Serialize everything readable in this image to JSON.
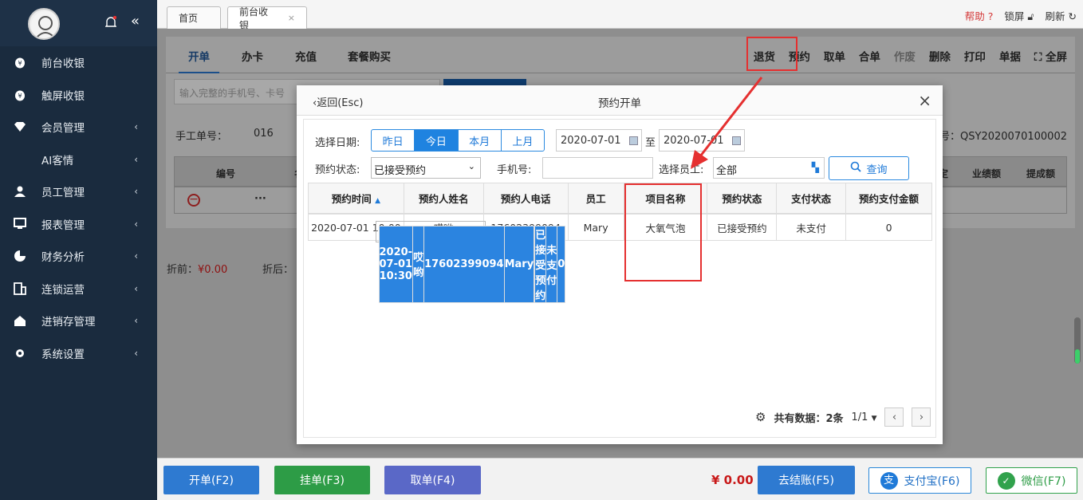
{
  "sidebar": {
    "items": [
      {
        "label": "前台收银",
        "icon": "cashier-icon",
        "arrow": ""
      },
      {
        "label": "触屏收银",
        "icon": "touch-cashier-icon",
        "arrow": ""
      },
      {
        "label": "会员管理",
        "icon": "diamond-icon",
        "arrow": "‹"
      },
      {
        "label": "AI客情",
        "icon": "",
        "arrow": "‹"
      },
      {
        "label": "员工管理",
        "icon": "person-icon",
        "arrow": "‹"
      },
      {
        "label": "报表管理",
        "icon": "monitor-icon",
        "arrow": "‹"
      },
      {
        "label": "财务分析",
        "icon": "pie-icon",
        "arrow": "‹"
      },
      {
        "label": "连锁运营",
        "icon": "building-icon",
        "arrow": "‹"
      },
      {
        "label": "进销存管理",
        "icon": "home-icon",
        "arrow": "‹"
      },
      {
        "label": "系统设置",
        "icon": "gear-icon",
        "arrow": "‹"
      }
    ]
  },
  "topbar": {
    "tabs": [
      {
        "label": "首页"
      },
      {
        "label": "前台收银",
        "close": "×"
      }
    ],
    "help": "帮助",
    "lock": "锁屏",
    "refresh": "刷新"
  },
  "main": {
    "subtabs": [
      "开单",
      "办卡",
      "充值",
      "套餐购买"
    ],
    "actions": [
      "退货",
      "预约",
      "取单",
      "合单",
      "作废",
      "删除",
      "打印",
      "单据",
      "全屏"
    ],
    "search_placeholder": "输入完整的手机号、卡号",
    "manual_label": "手工单号：",
    "manual_value": "016",
    "order_no": "号：QSY2020070100002",
    "grid_headers": [
      "编号",
      "名",
      "定",
      "业绩额",
      "提成额"
    ],
    "row_dots": "···",
    "discount_before_label": "折前：",
    "discount_before_value": "¥0.00",
    "discount_after_label": "折后："
  },
  "bottom": {
    "open": "开单(F2)",
    "hang": "挂单(F3)",
    "take": "取单(F4)",
    "total": "¥ 0.00",
    "checkout": "去结账(F5)",
    "alipay": "支付宝(F6)",
    "wechat": "微信(F7)"
  },
  "modal": {
    "back": "返回(Esc)",
    "title": "预约开单",
    "close": "×",
    "date_label": "选择日期:",
    "date_buttons": [
      "昨日",
      "今日",
      "本月",
      "上月"
    ],
    "date_from": "2020-07-01",
    "date_sep": "至",
    "date_to": "2020-07-01",
    "status_label": "预约状态:",
    "status_value": "已接受预约",
    "phone_label": "手机号:",
    "employee_label": "选择员工:",
    "employee_value": "全部",
    "query": "查询",
    "table": {
      "headers": [
        "预约时间",
        "预约人姓名",
        "预约人电话",
        "员工",
        "项目名称",
        "预约状态",
        "支付状态",
        "预约支付金额"
      ],
      "rows": [
        [
          "2020-07-01 10:30",
          "哎哟",
          "17602399094",
          "Mary",
          "",
          "已接受预约",
          "未支付",
          "0"
        ],
        [
          "2020-07-01 10:00",
          "哎哟",
          "17602399094",
          "Mary",
          "大氧气泡",
          "已接受预约",
          "未支付",
          "0"
        ]
      ]
    },
    "total_label": "共有数据：2条",
    "page": "1/1"
  },
  "colors": {
    "sidebar": "#1a2b3e",
    "primary": "#2b84e0",
    "accent_red": "#e53030",
    "green": "#31a24c",
    "purple": "#5a68c7"
  }
}
